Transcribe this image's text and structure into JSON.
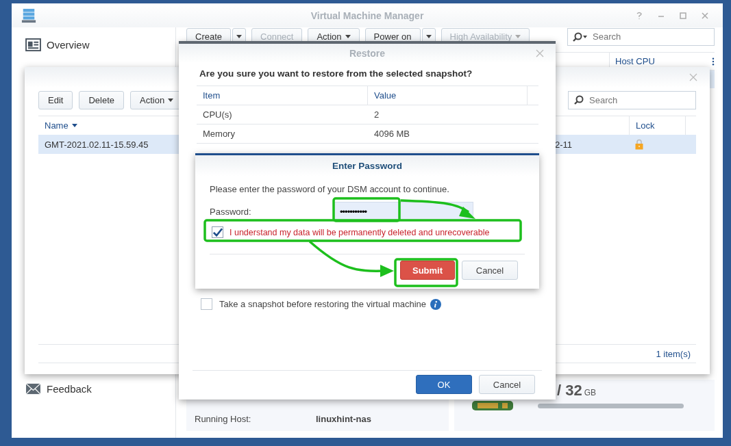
{
  "main_window": {
    "title": "Virtual Machine Manager",
    "sidebar": {
      "items": [
        {
          "label": "Overview",
          "kind": "overview"
        },
        {
          "label": "Feedback",
          "kind": "feedback"
        }
      ]
    },
    "toolbar": [
      {
        "label": "Create",
        "disabled": false,
        "kind": "split"
      },
      {
        "label": "Connect",
        "disabled": true,
        "kind": "plain"
      },
      {
        "label": "Action",
        "disabled": false,
        "kind": "menu"
      },
      {
        "label": "Power on",
        "disabled": false,
        "kind": "split"
      },
      {
        "label": "High Availability",
        "disabled": true,
        "kind": "menu"
      }
    ],
    "search": {
      "placeholder": "Search"
    },
    "table": {
      "columns": [
        "Host CPU"
      ]
    },
    "details": [
      {
        "label": "Running Host:",
        "value": "linuxhint-nas"
      }
    ],
    "memory": {
      "amount": "/ 32",
      "unit": "GB"
    }
  },
  "snapshot_window": {
    "toolbar": [
      {
        "label": "Edit",
        "dropdown": false
      },
      {
        "label": "Delete",
        "dropdown": false
      },
      {
        "label": "Action",
        "dropdown": true
      }
    ],
    "search": {
      "placeholder": "Search"
    },
    "table": {
      "columns": [
        {
          "label": "Name",
          "sorted": true
        },
        {
          "label": "Lock",
          "sorted": false
        }
      ],
      "rows": [
        {
          "name": "GMT-2021.02.11-15.59.45",
          "date": "2-11",
          "locked": true,
          "selected": true
        }
      ]
    },
    "footer": "1 item(s)"
  },
  "restore_dialog": {
    "title": "Restore",
    "question": "Are you sure you want to restore from the selected snapshot?",
    "table": {
      "columns": [
        "Item",
        "Value"
      ],
      "rows": [
        [
          "CPU(s)",
          "2"
        ],
        [
          "Memory",
          "4096 MB"
        ]
      ]
    },
    "snapshot_option": {
      "label": "Take a snapshot before restoring the virtual machine",
      "checked": false
    },
    "buttons": [
      {
        "label": "OK",
        "kind": "primary"
      },
      {
        "label": "Cancel",
        "kind": "default"
      }
    ]
  },
  "password_dialog": {
    "title": "Enter Password",
    "message": "Please enter the password of your DSM account to continue.",
    "password": {
      "label": "Password:",
      "value": "•••••••••••"
    },
    "confirm": {
      "label": "I understand my data will be permanently deleted and unrecoverable",
      "checked": true
    },
    "buttons": [
      {
        "label": "Submit",
        "kind": "danger"
      },
      {
        "label": "Cancel",
        "kind": "default"
      }
    ]
  }
}
